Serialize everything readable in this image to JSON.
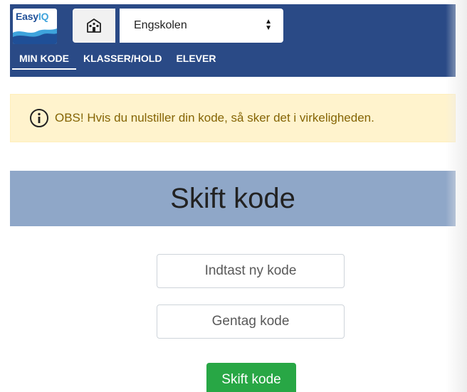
{
  "header": {
    "logo": {
      "name": "Easy",
      "suffix": "IQ"
    },
    "school_icon": "school-icon",
    "school_select": {
      "value": "Engskolen",
      "arrows": "▲▼"
    },
    "nav": [
      {
        "label": "MIN KODE",
        "active": true
      },
      {
        "label": "KLASSER/HOLD",
        "active": false
      },
      {
        "label": "ELEVER",
        "active": false
      }
    ]
  },
  "alert": {
    "icon": "info-circle-icon",
    "text": "OBS! Hvis du nulstiller din kode, så sker det i virkeligheden."
  },
  "card": {
    "title": "Skift kode",
    "new_code_placeholder": "Indtast ny kode",
    "repeat_code_placeholder": "Gentag kode",
    "submit_label": "Skift kode"
  },
  "colors": {
    "header_bg": "#2a4a86",
    "alert_bg": "#fff3cd",
    "alert_text": "#856404",
    "card_header_bg": "#8fa7c8",
    "submit_bg": "#28a745"
  }
}
